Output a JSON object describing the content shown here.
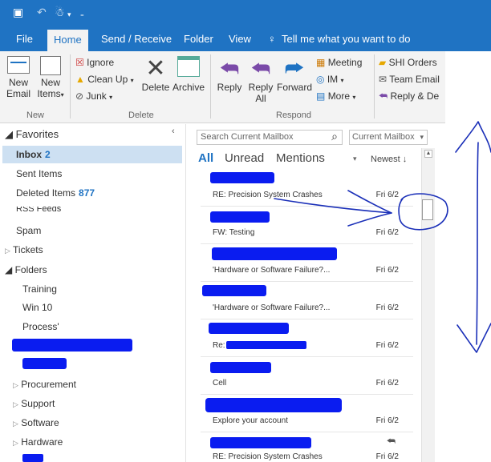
{
  "titlebar": {
    "icons": [
      "app-icon",
      "undo-icon",
      "person-icon",
      "dropdown-icon"
    ]
  },
  "tabs": [
    {
      "label": "File",
      "active": false
    },
    {
      "label": "Home",
      "active": true
    },
    {
      "label": "Send / Receive",
      "active": false
    },
    {
      "label": "Folder",
      "active": false
    },
    {
      "label": "View",
      "active": false
    },
    {
      "label": "Tell me what you want to do",
      "active": false
    }
  ],
  "ribbon": {
    "new_email": "New\nEmail",
    "new_items": "New\nItems",
    "new_group": "New",
    "ignore": "Ignore",
    "cleanup": "Clean Up",
    "junk": "Junk",
    "delete": "Delete",
    "archive": "Archive",
    "delete_group": "Delete",
    "reply": "Reply",
    "reply_all": "Reply\nAll",
    "forward": "Forward",
    "meeting": "Meeting",
    "im": "IM",
    "more": "More",
    "respond_group": "Respond",
    "quick1": "SHI Orders",
    "quick2": "Team Email",
    "quick3": "Reply & De"
  },
  "folders": {
    "favorites": "Favorites",
    "inbox": "Inbox",
    "inbox_count": "2",
    "sent": "Sent Items",
    "deleted": "Deleted Items",
    "deleted_count": "877",
    "rss": "RSS Feeds",
    "spam": "Spam",
    "tickets": "Tickets",
    "folders": "Folders",
    "training": "Training",
    "win10": "Win 10",
    "process": "Process'",
    "procurement": "Procurement",
    "support": "Support",
    "software": "Software",
    "hardware": "Hardware"
  },
  "list": {
    "search_placeholder": "Search Current Mailbox",
    "scope": "Current Mailbox",
    "filter_all": "All",
    "filter_unread": "Unread",
    "filter_mentions": "Mentions",
    "sort": "Newest",
    "messages": [
      {
        "subject": "RE: Precision System Crashes",
        "date": "Fri 6/2"
      },
      {
        "subject": "FW: Testing",
        "date": "Fri 6/2"
      },
      {
        "subject": "'Hardware or Software Failure?...",
        "date": "Fri 6/2"
      },
      {
        "subject": "'Hardware or Software Failure?...",
        "date": "Fri 6/2"
      },
      {
        "subject": "Re:",
        "date": "Fri 6/2"
      },
      {
        "subject": "Cell",
        "date": "Fri 6/2"
      },
      {
        "subject": "Explore your account",
        "date": "Fri 6/2"
      },
      {
        "subject": "RE: Precision System Crashes",
        "date": "Fri 6/2"
      }
    ]
  },
  "colors": {
    "accent": "#1f73c3",
    "redaction": "#0a1cf0",
    "annotation": "#1a2fb8"
  }
}
